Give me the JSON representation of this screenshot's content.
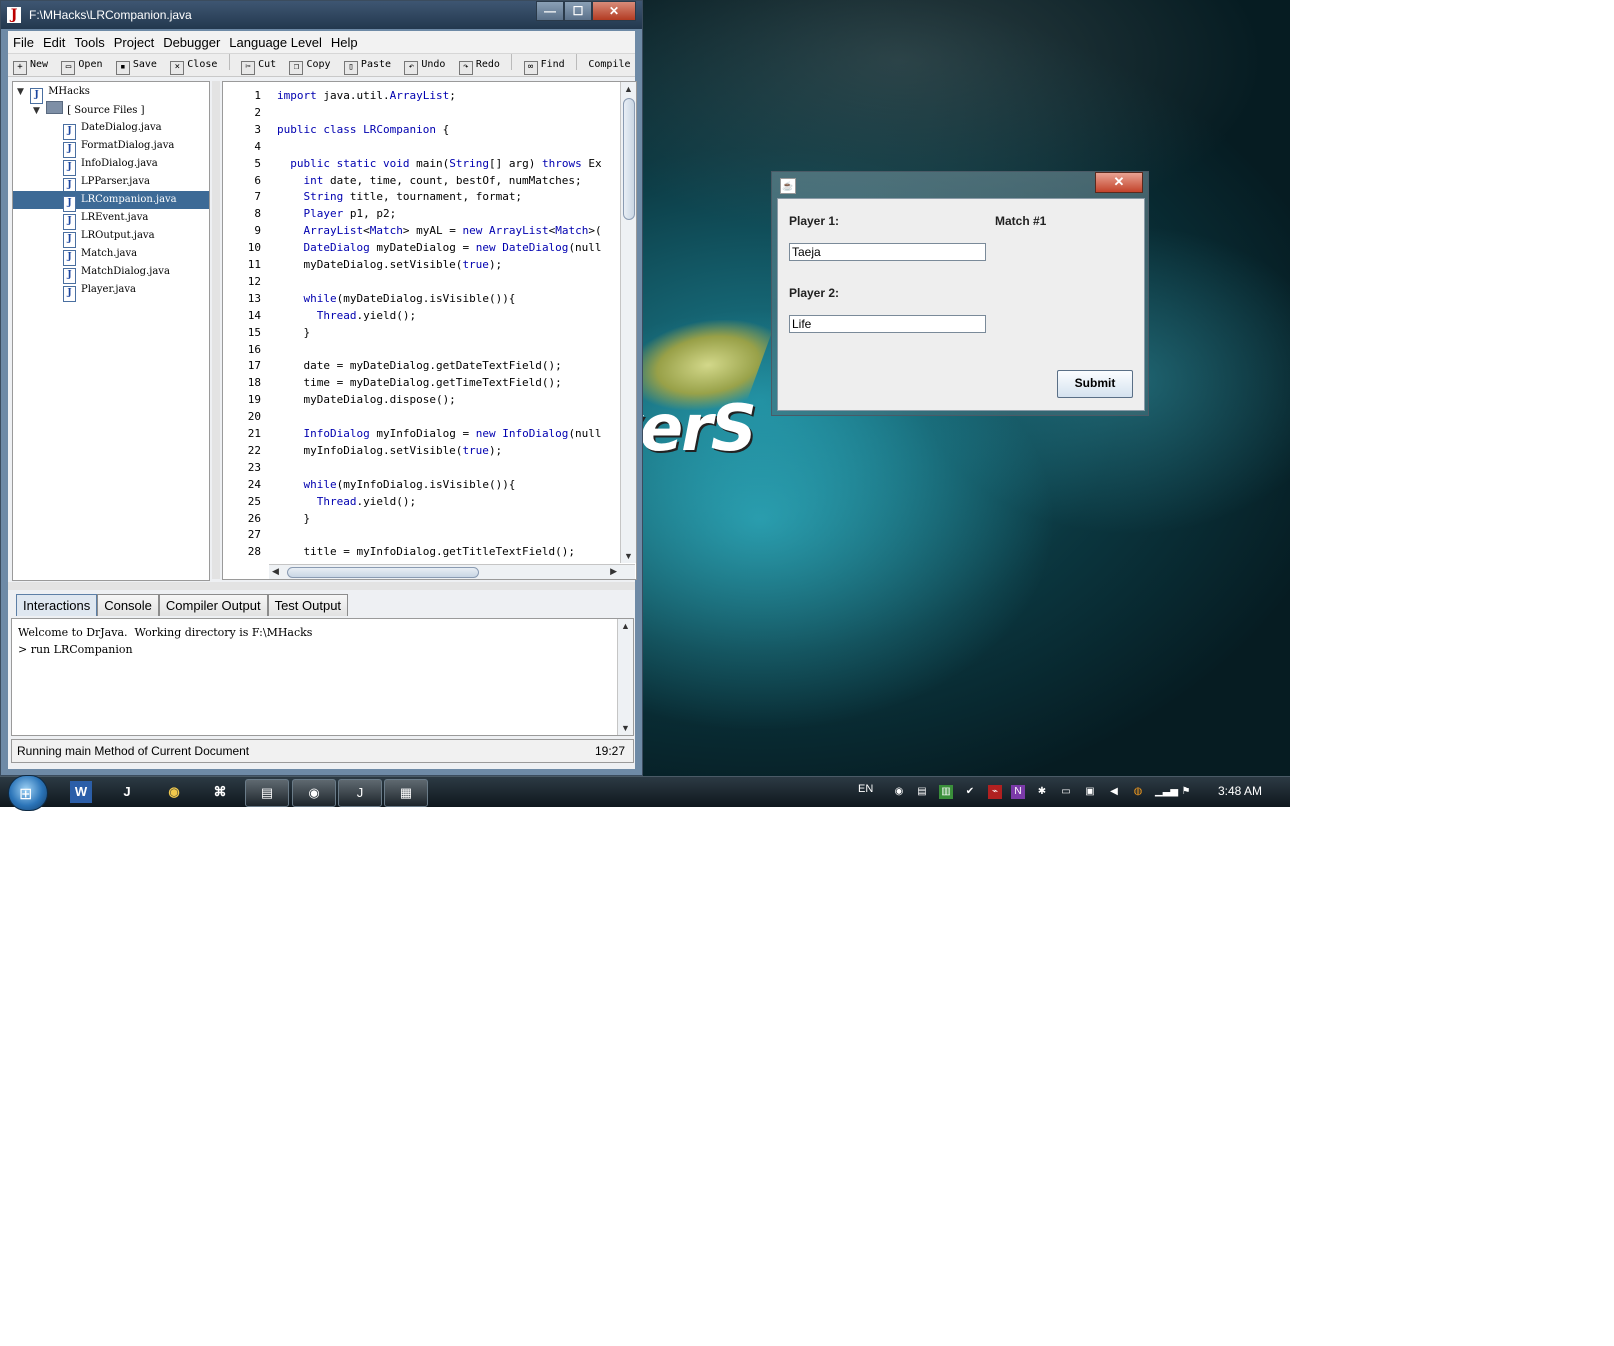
{
  "drjava": {
    "title": "F:\\MHacks\\LRCompanion.java",
    "window_buttons": {
      "minimize": "—",
      "maximize": "☐",
      "close": "✕"
    },
    "menu": [
      "File",
      "Edit",
      "Tools",
      "Project",
      "Debugger",
      "Language Level",
      "Help"
    ],
    "toolbar": [
      {
        "label": "New",
        "icon": "new-file-icon"
      },
      {
        "label": "Open",
        "icon": "open-folder-icon"
      },
      {
        "label": "Save",
        "icon": "save-icon"
      },
      {
        "label": "Close",
        "icon": "close-file-icon"
      },
      {
        "label": "Cut",
        "icon": "scissors-icon"
      },
      {
        "label": "Copy",
        "icon": "copy-icon"
      },
      {
        "label": "Paste",
        "icon": "paste-icon"
      },
      {
        "label": "Undo",
        "icon": "undo-icon"
      },
      {
        "label": "Redo",
        "icon": "redo-icon"
      },
      {
        "label": "Find",
        "icon": "binoculars-icon"
      },
      {
        "label": "Compile Project",
        "icon": ""
      }
    ],
    "tree": {
      "root": "MHacks",
      "folder": "[ Source Files ]",
      "files": [
        "DateDialog.java",
        "FormatDialog.java",
        "InfoDialog.java",
        "LPParser.java",
        "LRCompanion.java",
        "LREvent.java",
        "LROutput.java",
        "Match.java",
        "MatchDialog.java",
        "Player.java"
      ],
      "selected": "LRCompanion.java"
    },
    "editor": {
      "lines": [
        "import java.util.ArrayList;",
        "",
        "public class LRCompanion {",
        "",
        "  public static void main(String[] arg) throws Ex",
        "    int date, time, count, bestOf, numMatches;",
        "    String title, tournament, format;",
        "    Player p1, p2;",
        "    ArrayList<Match> myAL = new ArrayList<Match>(",
        "    DateDialog myDateDialog = new DateDialog(null",
        "    myDateDialog.setVisible(true);",
        "",
        "    while(myDateDialog.isVisible()){",
        "      Thread.yield();",
        "    }",
        "",
        "    date = myDateDialog.getDateTextField();",
        "    time = myDateDialog.getTimeTextField();",
        "    myDateDialog.dispose();",
        "",
        "    InfoDialog myInfoDialog = new InfoDialog(null",
        "    myInfoDialog.setVisible(true);",
        "",
        "    while(myInfoDialog.isVisible()){",
        "      Thread.yield();",
        "    }",
        "",
        "    title = myInfoDialog.getTitleTextField();"
      ]
    },
    "tabs": [
      "Interactions",
      "Console",
      "Compiler Output",
      "Test Output"
    ],
    "active_tab": "Interactions",
    "interactions": [
      "Welcome to DrJava.  Working directory is F:\\MHacks",
      "> run LRCompanion"
    ],
    "status": {
      "message": "Running main Method of Current Document",
      "position": "19:27"
    }
  },
  "dialog": {
    "player1_label": "Player 1:",
    "player1_value": "Taeja",
    "player2_label": "Player 2:",
    "player2_value": "Life",
    "match_label": "Match #1",
    "submit_label": "Submit",
    "close": "✕"
  },
  "wallpaper": {
    "text": "yerS"
  },
  "taskbar": {
    "start": "⊞",
    "pinned": [
      "W",
      "J",
      "◉",
      "⌘"
    ],
    "tasks": [
      "▤",
      "◉",
      "J",
      "▦"
    ],
    "language": "EN",
    "clock": "3:48 AM"
  }
}
